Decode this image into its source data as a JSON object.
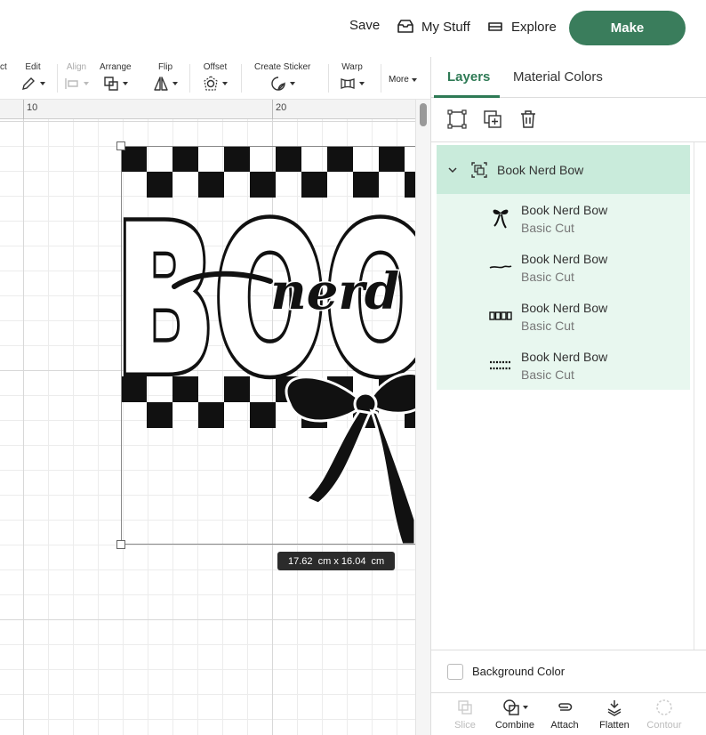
{
  "header": {
    "save_label": "Save",
    "mystuff_label": "My Stuff",
    "explore_label": "Explore",
    "make_label": "Make"
  },
  "toolbar": {
    "select_label": "ct",
    "edit_label": "Edit",
    "align_label": "Align",
    "arrange_label": "Arrange",
    "flip_label": "Flip",
    "offset_label": "Offset",
    "sticker_label": "Create Sticker",
    "warp_label": "Warp",
    "more_label": "More"
  },
  "canvas": {
    "ruler": [
      "10",
      "20"
    ],
    "dimensions": "17.62  cm x 16.04  cm",
    "artwork_text": {
      "main": "BOO",
      "script": "nerd"
    }
  },
  "panel": {
    "tabs": [
      {
        "label": "Layers",
        "active": true
      },
      {
        "label": "Material Colors",
        "active": false
      }
    ],
    "group": {
      "name": "Book Nerd Bow"
    },
    "children": [
      {
        "name": "Book Nerd Bow",
        "sub": "Basic Cut",
        "thumb": "bow-thumbnail"
      },
      {
        "name": "Book Nerd Bow",
        "sub": "Basic Cut",
        "thumb": "script-thumbnail"
      },
      {
        "name": "Book Nerd Bow",
        "sub": "Basic Cut",
        "thumb": "book-text-thumbnail"
      },
      {
        "name": "Book Nerd Bow",
        "sub": "Basic Cut",
        "thumb": "checker-thumbnail"
      }
    ],
    "background_color_label": "Background Color",
    "actions": {
      "slice": "Slice",
      "combine": "Combine",
      "attach": "Attach",
      "flatten": "Flatten",
      "contour": "Contour"
    }
  },
  "colors": {
    "accent": "#2e7a55",
    "make_button": "#3a7d5c",
    "group_bg": "#c9ebdb",
    "children_bg": "#e8f7ef"
  }
}
